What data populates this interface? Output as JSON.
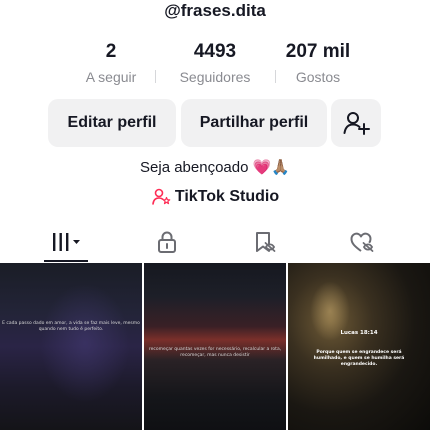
{
  "profile": {
    "username": "@frases.dita",
    "bio": "Seja abençoado 💗🙏🏽",
    "studio_label": "TikTok Studio"
  },
  "stats": [
    {
      "value": "2",
      "label": "A seguir"
    },
    {
      "value": "4493",
      "label": "Seguidores"
    },
    {
      "value": "207 mil",
      "label": "Gostos"
    }
  ],
  "buttons": {
    "edit": "Editar perfil",
    "share": "Partilhar perfil"
  },
  "tabs": [
    {
      "icon": "videos-grid-icon",
      "active": true
    },
    {
      "icon": "lock-icon",
      "active": false
    },
    {
      "icon": "bookmark-icon",
      "active": false
    },
    {
      "icon": "liked-heart-icon",
      "active": false
    }
  ],
  "videos": [
    {
      "caption": "E cada passo dado em amor, a vida se faz mais leve, mesmo quando nem tudo é perfeito."
    },
    {
      "caption": "recomeçar quantas vezes for necessário, recalcular a rota, recomeçar, mas nunca desistir"
    },
    {
      "title": "Lucas 18:14",
      "caption": "Porque quem se engrandece será humilhado, e quem se humilha será engrandecido."
    }
  ],
  "colors": {
    "text": "#161823",
    "muted": "#8a8b91",
    "button_bg": "#f1f1f2",
    "heart": "#fe2c55"
  }
}
